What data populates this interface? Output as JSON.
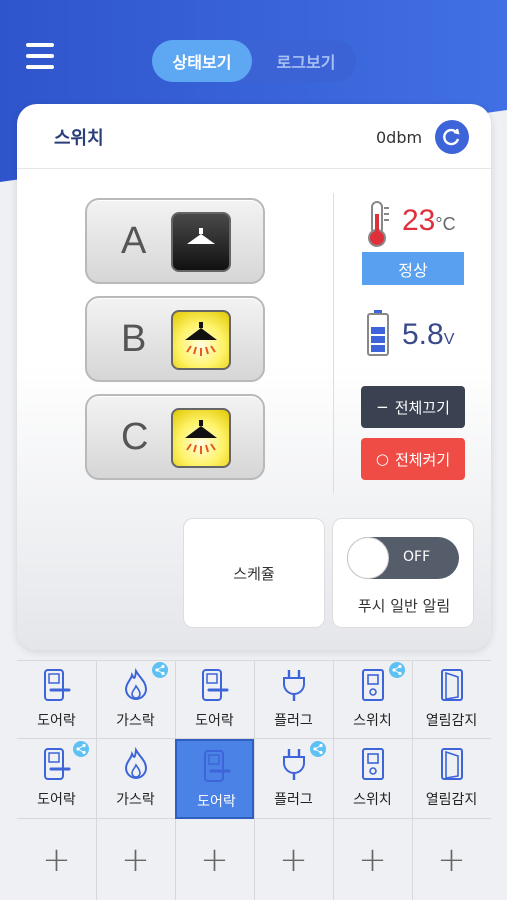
{
  "header": {
    "tabs": [
      {
        "label": "상태보기",
        "active": true
      },
      {
        "label": "로그보기",
        "active": false
      }
    ]
  },
  "card": {
    "title": "스위치",
    "signal": "0dbm",
    "switches": [
      {
        "label": "A",
        "state": "off"
      },
      {
        "label": "B",
        "state": "on"
      },
      {
        "label": "C",
        "state": "on"
      }
    ],
    "temperature": {
      "value": "23",
      "unit": "°C"
    },
    "status": "정상",
    "voltage": {
      "value": "5.8",
      "unit": "V"
    },
    "all_off_label": "전체끄기",
    "all_on_label": "전체켜기",
    "schedule_label": "스케쥴",
    "push": {
      "toggle": "OFF",
      "label": "푸시 일반 알림"
    }
  },
  "devices": {
    "row1": [
      {
        "name": "도어락",
        "icon": "door-lock-icon",
        "shared": false,
        "selected": false
      },
      {
        "name": "가스락",
        "icon": "gas-lock-icon",
        "shared": true,
        "selected": false
      },
      {
        "name": "도어락",
        "icon": "door-lock-icon",
        "shared": false,
        "selected": false
      },
      {
        "name": "플러그",
        "icon": "plug-icon",
        "shared": false,
        "selected": false
      },
      {
        "name": "스위치",
        "icon": "switch-icon",
        "shared": true,
        "selected": false
      },
      {
        "name": "열림감지",
        "icon": "door-sensor-icon",
        "shared": false,
        "selected": false
      }
    ],
    "row2": [
      {
        "name": "도어락",
        "icon": "door-lock-icon",
        "shared": true,
        "selected": false
      },
      {
        "name": "가스락",
        "icon": "gas-lock-icon",
        "shared": false,
        "selected": false
      },
      {
        "name": "도어락",
        "icon": "door-lock-icon",
        "shared": false,
        "selected": true
      },
      {
        "name": "플러그",
        "icon": "plug-icon",
        "shared": true,
        "selected": false
      },
      {
        "name": "스위치",
        "icon": "switch-icon",
        "shared": false,
        "selected": false
      },
      {
        "name": "열림감지",
        "icon": "door-sensor-icon",
        "shared": false,
        "selected": false
      }
    ],
    "add_symbol": "+"
  },
  "colors": {
    "primary": "#3d64d8",
    "danger": "#ee4c44",
    "dark": "#3a4252",
    "temp": "#e0303c"
  }
}
